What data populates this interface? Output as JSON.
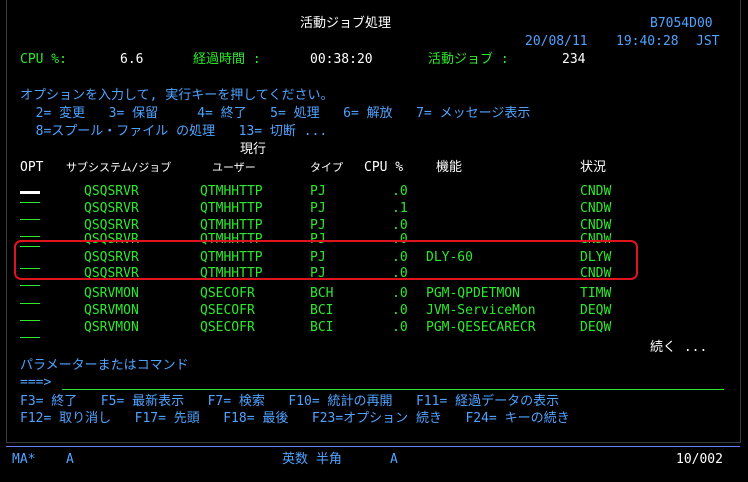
{
  "header": {
    "title": "活動ジョブ処理",
    "system_name": "B7054D00",
    "date": "20/08/11",
    "time": "19:40:28",
    "timezone": "JST",
    "cpu_label": "CPU %:",
    "cpu_value": "6.6",
    "elapsed_label": "経過時間 :",
    "elapsed_value": "00:38:20",
    "active_jobs_label": "活動ジョブ :",
    "active_jobs_value": "234"
  },
  "instructions": {
    "prompt": "オプションを入力して, 実行キーを押してください。",
    "line1": "  2= 変更   3= 保留     4= 終了   5= 処理   6= 解放   7= メッセージ表示",
    "line2": "  8=スプール・ファイル の処理   13= 切断 ..."
  },
  "table": {
    "header_line1": "現行",
    "headers": {
      "opt": "OPT",
      "subsystem_job": "サブシステム/ジョブ",
      "user": "ユーザー",
      "type": "タイプ",
      "cpu": "CPU %",
      "function": "機能",
      "status": "状況"
    },
    "rows": [
      {
        "job": "QSQSRVR",
        "user": "QTMHHTTP",
        "type": "PJ",
        "cpu": ".0",
        "function": "",
        "status": "CNDW"
      },
      {
        "job": "QSQSRVR",
        "user": "QTMHHTTP",
        "type": "PJ",
        "cpu": ".1",
        "function": "",
        "status": "CNDW"
      },
      {
        "job": "QSQSRVR",
        "user": "QTMHHTTP",
        "type": "PJ",
        "cpu": ".0",
        "function": "",
        "status": "CNDW"
      },
      {
        "job": "QSQSRVR",
        "user": "QTMHHTTP",
        "type": "PJ",
        "cpu": ".0",
        "function": "",
        "status": "CNDW"
      },
      {
        "job": "QSQSRVR",
        "user": "QTMHHTTP",
        "type": "PJ",
        "cpu": ".0",
        "function": "DLY-60",
        "status": "DLYW"
      },
      {
        "job": "QSQSRVR",
        "user": "QTMHHTTP",
        "type": "PJ",
        "cpu": ".0",
        "function": "",
        "status": "CNDW"
      },
      {
        "job": "QSRVMON",
        "user": "QSECOFR",
        "type": "BCH",
        "cpu": ".0",
        "function": "PGM-QPDETMON",
        "status": "TIMW"
      },
      {
        "job": "QSRVMON",
        "user": "QSECOFR",
        "type": "BCI",
        "cpu": ".0",
        "function": "JVM-ServiceMon",
        "status": "DEQW"
      },
      {
        "job": "QSRVMON",
        "user": "QSECOFR",
        "type": "BCI",
        "cpu": ".0",
        "function": "PGM-QESECARECR",
        "status": "DEQW"
      }
    ],
    "more": "続く ..."
  },
  "command": {
    "label": "パラメーターまたはコマンド",
    "prompt": "===>"
  },
  "function_keys": {
    "line1": "F3= 終了   F5= 最新表示   F7= 検索   F10= 統計の再開   F11= 経過データの表示",
    "line2": "F12= 取り消し   F17= 先頭   F18= 最後   F23=オプション 続き   F24= キーの続き"
  },
  "status_bar": {
    "session": "MA*",
    "mode": "A",
    "input_mode": "英数 半角",
    "input_flag": "A",
    "cursor_pos": "10/002"
  }
}
